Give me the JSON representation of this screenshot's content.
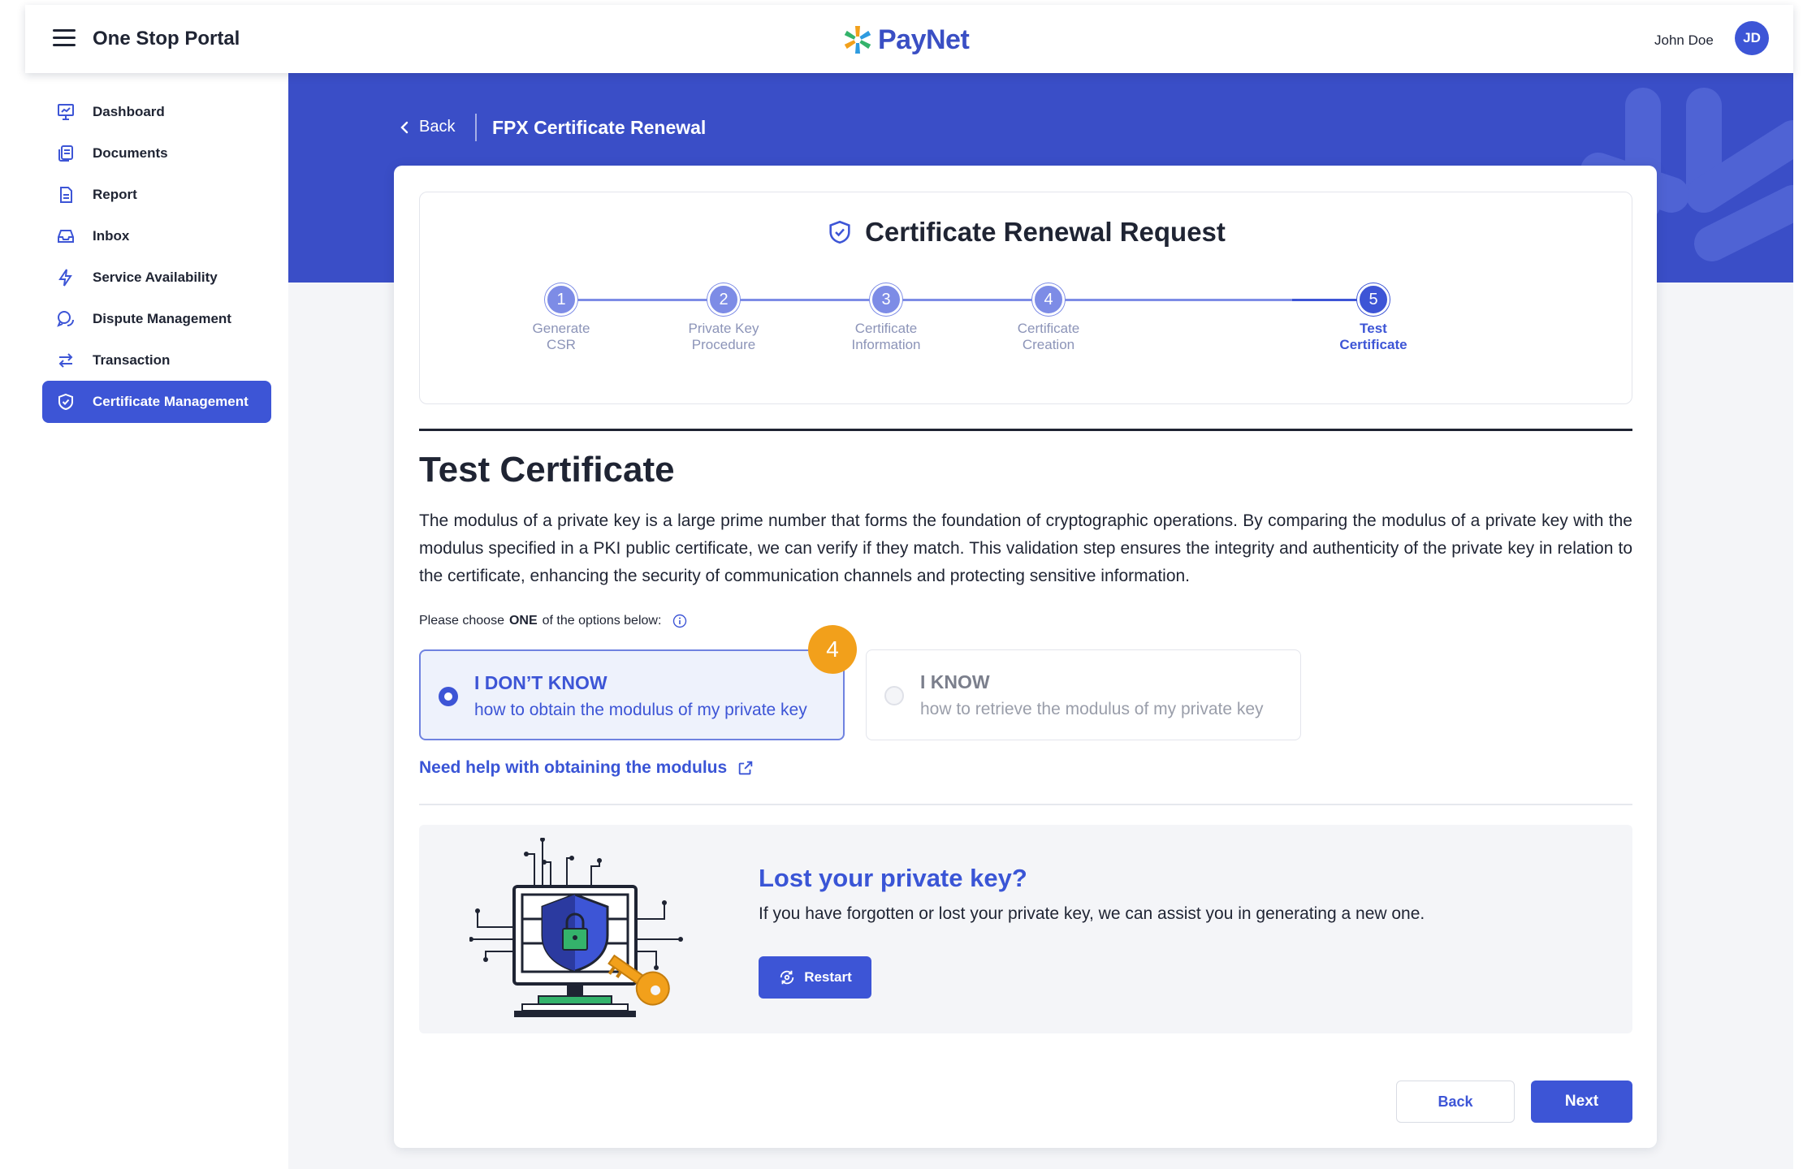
{
  "header": {
    "app_title": "One Stop Portal",
    "logo_text": "PayNet",
    "user_name": "John Doe",
    "user_initials": "JD"
  },
  "sidebar": {
    "items": [
      {
        "label": "Dashboard",
        "icon": "dashboard-icon"
      },
      {
        "label": "Documents",
        "icon": "documents-icon"
      },
      {
        "label": "Report",
        "icon": "report-icon"
      },
      {
        "label": "Inbox",
        "icon": "inbox-icon"
      },
      {
        "label": "Service Availability",
        "icon": "lightning-icon"
      },
      {
        "label": "Dispute Management",
        "icon": "chat-icon"
      },
      {
        "label": "Transaction",
        "icon": "arrows-icon"
      },
      {
        "label": "Certificate Management",
        "icon": "shield-icon",
        "active": true
      }
    ]
  },
  "breadcrumb": {
    "back_label": "Back",
    "page_title": "FPX Certificate Renewal"
  },
  "stepper": {
    "title": "Certificate Renewal Request",
    "steps": [
      {
        "number": "1",
        "label_line1": "Generate",
        "label_line2": "CSR"
      },
      {
        "number": "2",
        "label_line1": "Private Key",
        "label_line2": "Procedure"
      },
      {
        "number": "3",
        "label_line1": "Certificate",
        "label_line2": "Information"
      },
      {
        "number": "4",
        "label_line1": "Certificate",
        "label_line2": "Creation"
      },
      {
        "number": "5",
        "label_line1": "Test",
        "label_line2": "Certificate",
        "current": true
      }
    ]
  },
  "section": {
    "title": "Test Certificate",
    "description": "The modulus of a private key is a large prime number that forms the foundation of cryptographic operations. By comparing the modulus of a private key with the modulus specified in a PKI public certificate, we can verify if they match. This validation step ensures the integrity and authenticity of the private key in relation to the certificate, enhancing the security of communication channels and protecting sensitive information.",
    "choose_prefix": "Please choose",
    "choose_bold": "ONE",
    "choose_suffix": "of the options below:"
  },
  "options": [
    {
      "title": "I DON’T KNOW",
      "subtitle": "how to obtain the modulus of my private key",
      "selected": true
    },
    {
      "title": "I KNOW",
      "subtitle": "how to retrieve the modulus of my private key",
      "selected": false
    }
  ],
  "annotation_badge": "4",
  "help_link": "Need help with obtaining the modulus",
  "lost_key": {
    "title": "Lost your private key?",
    "text": "If you have forgotten or lost your private key, we can assist you in generating a new one.",
    "button_label": "Restart"
  },
  "footer": {
    "back_label": "Back",
    "next_label": "Next"
  },
  "colors": {
    "primary": "#3d55d6",
    "banner": "#3a4ec7",
    "badge": "#f2a01b"
  }
}
